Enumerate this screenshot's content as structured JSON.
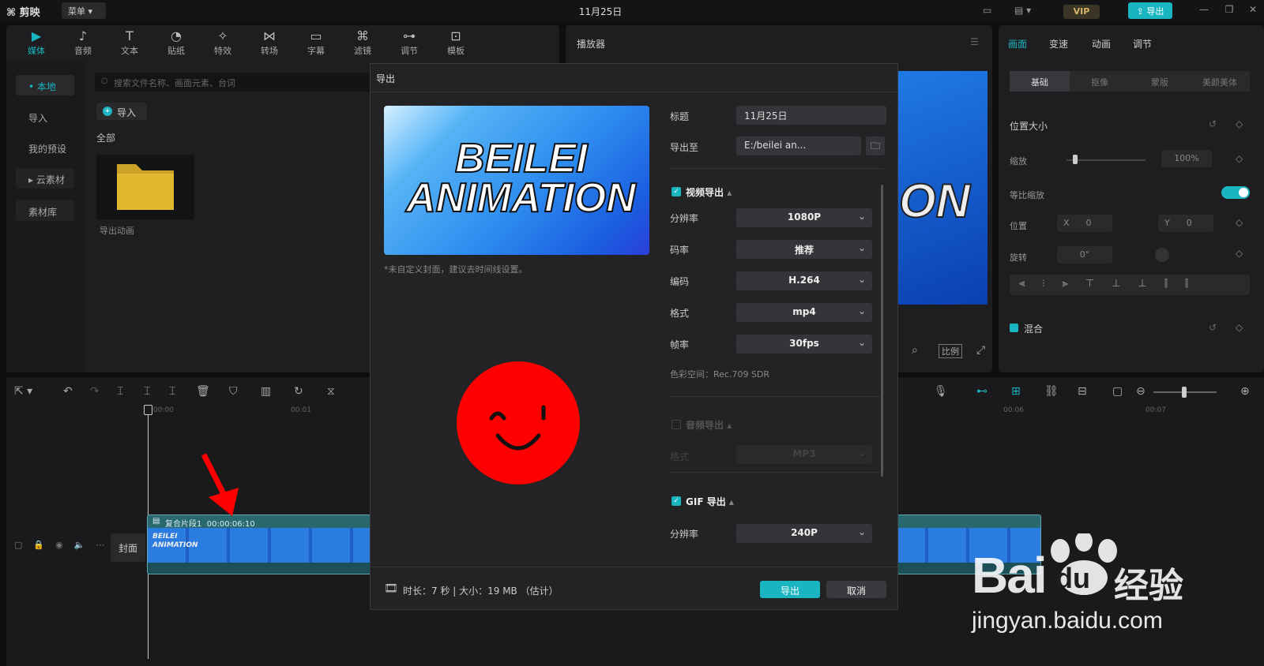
{
  "app": {
    "logo": "剪映",
    "menu": "菜单",
    "title": "11月25日",
    "vip": "VIP",
    "export": "导出"
  },
  "toolbar": [
    {
      "label": "媒体",
      "icon": "media-icon"
    },
    {
      "label": "音频",
      "icon": "audio-icon"
    },
    {
      "label": "文本",
      "icon": "text-icon"
    },
    {
      "label": "贴纸",
      "icon": "sticker-icon"
    },
    {
      "label": "特效",
      "icon": "effects-icon"
    },
    {
      "label": "转场",
      "icon": "transition-icon"
    },
    {
      "label": "字幕",
      "icon": "subtitle-icon"
    },
    {
      "label": "滤镜",
      "icon": "filter-icon"
    },
    {
      "label": "调节",
      "icon": "adjust-icon"
    },
    {
      "label": "模板",
      "icon": "template-icon"
    }
  ],
  "sidebar": {
    "items": [
      "本地",
      "导入",
      "我的预设",
      "云素材",
      "素材库"
    ]
  },
  "media": {
    "search_placeholder": "搜索文件名称、画面元素、台词",
    "import": "导入",
    "all": "全部",
    "folder_name": "导出动画"
  },
  "player": {
    "title": "播放器",
    "ratio": "比例",
    "preview_text": "ON"
  },
  "attributes": {
    "tabs": [
      "画面",
      "变速",
      "动画",
      "调节"
    ],
    "subtabs": [
      "基础",
      "抠像",
      "蒙版",
      "美颜美体"
    ],
    "section": "位置大小",
    "scale_label": "缩放",
    "scale_value": "100%",
    "uniform_scale": "等比缩放",
    "position_label": "位置",
    "x_label": "X",
    "x_value": "0",
    "y_label": "Y",
    "y_value": "0",
    "rotate_label": "旋转",
    "rotate_value": "0°",
    "blend": "混合"
  },
  "timeline": {
    "ticks": [
      "00:00",
      "00:01",
      "00:06",
      "00:07"
    ],
    "clip_name": "复合片段1",
    "clip_duration": "00:00:06:10",
    "cover": "封面",
    "thumb_text_1": "BEILEI",
    "thumb_text_2": "ANIMATION"
  },
  "dialog": {
    "title": "导出",
    "cover_line1": "BEILEI",
    "cover_line2": "ANIMATION",
    "cover_note": "*未自定义封面，建议去时间线设置。",
    "title_label": "标题",
    "title_value": "11月25日",
    "path_label": "导出至",
    "path_value": "E:/beilei an...",
    "video_section": "视频导出",
    "resolution_label": "分辨率",
    "resolution_value": "1080P",
    "bitrate_label": "码率",
    "bitrate_value": "推荐",
    "codec_label": "编码",
    "codec_value": "H.264",
    "format_label": "格式",
    "format_value": "mp4",
    "fps_label": "帧率",
    "fps_value": "30fps",
    "color_space": "色彩空间：Rec.709 SDR",
    "audio_section": "音频导出",
    "audio_format_label": "格式",
    "audio_format_value": "MP3",
    "gif_section": "GIF 导出",
    "gif_resolution_label": "分辨率",
    "gif_resolution_value": "240P",
    "footer_info": "时长：7 秒 | 大小：19 MB （估计）",
    "export_button": "导出",
    "cancel_button": "取消"
  },
  "watermark": {
    "brand": "Bai",
    "brand2": "du",
    "cn": "经验",
    "url": "jingyan.baidu.com"
  },
  "colors": {
    "accent": "#19b5c0",
    "smiley": "#ff0000",
    "arrow": "#ff0000"
  }
}
